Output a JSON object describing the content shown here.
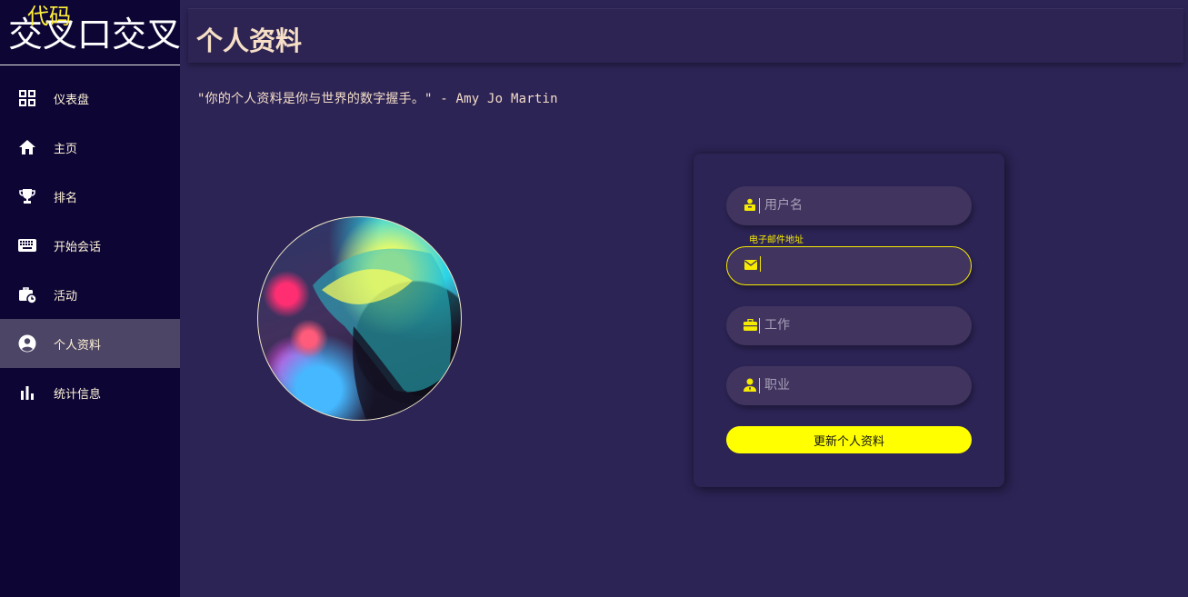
{
  "logo": {
    "main": "交叉口交叉",
    "tag": "代码"
  },
  "sidebar": {
    "items": [
      {
        "label": "仪表盘",
        "icon": "dashboard-icon",
        "active": false
      },
      {
        "label": "主页",
        "icon": "home-icon",
        "active": false
      },
      {
        "label": "排名",
        "icon": "trophy-icon",
        "active": false
      },
      {
        "label": "开始会话",
        "icon": "keyboard-icon",
        "active": false
      },
      {
        "label": "活动",
        "icon": "briefcase-clock-icon",
        "active": false
      },
      {
        "label": "个人资料",
        "icon": "account-circle-icon",
        "active": true
      },
      {
        "label": "统计信息",
        "icon": "bar-chart-icon",
        "active": false
      }
    ]
  },
  "header": {
    "title": "个人资料"
  },
  "quote": "\"你的个人资料是你与世界的数字握手。\" - Amy Jo Martin",
  "form": {
    "username": {
      "placeholder": "用户名",
      "value": "",
      "icon": "user-badge-icon"
    },
    "email": {
      "label": "电子邮件地址",
      "placeholder": "",
      "value": "",
      "icon": "envelope-icon"
    },
    "work": {
      "placeholder": "工作",
      "value": "",
      "icon": "briefcase-icon"
    },
    "occupation": {
      "placeholder": "职业",
      "value": "",
      "icon": "user-tie-icon"
    },
    "submit_label": "更新个人资料"
  },
  "colors": {
    "sidebar_bg": "#0d0634",
    "page_bg": "#2c2455",
    "accent_yellow": "#ffff00",
    "active_item_bg": "#4d4565",
    "title_text": "#f6dfc6"
  }
}
